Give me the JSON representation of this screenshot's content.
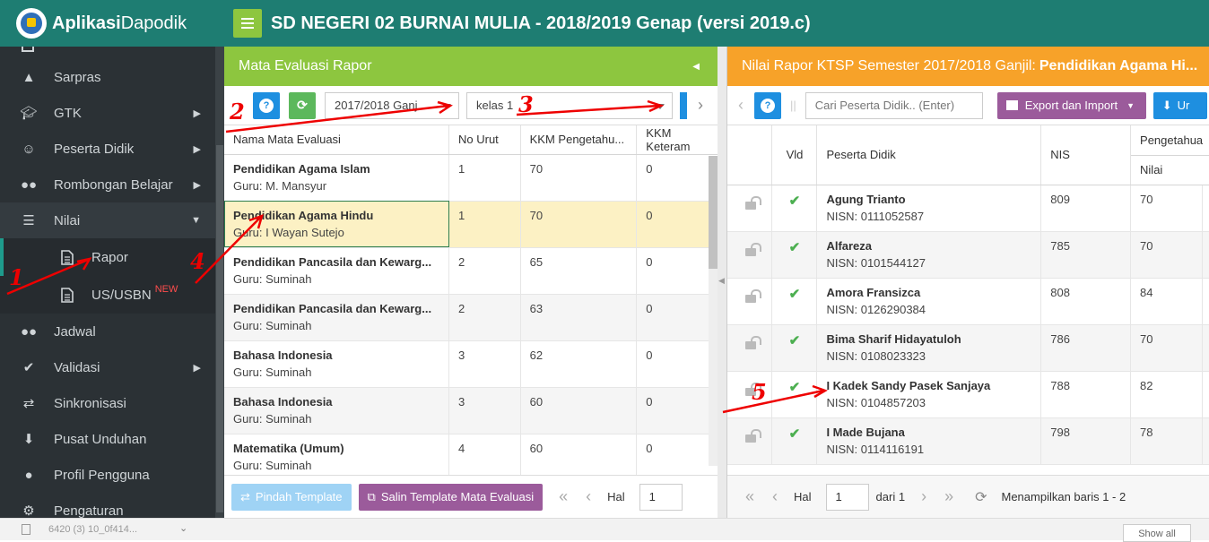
{
  "app": {
    "brand_bold": "Aplikasi",
    "brand_rest": "Dapodik",
    "title": "SD NEGERI 02 BURNAI MULIA - 2018/2019 Genap (versi 2019.c)"
  },
  "sidebar": {
    "items": [
      {
        "label": "Sarpras",
        "icon": "building-icon"
      },
      {
        "label": "GTK",
        "icon": "graduation-cap-icon"
      },
      {
        "label": "Peserta Didik",
        "icon": "smile-icon"
      },
      {
        "label": "Rombongan Belajar",
        "icon": "group-icon"
      },
      {
        "label": "Nilai",
        "icon": "list-icon"
      },
      {
        "label": "Rapor",
        "icon": "file-icon"
      },
      {
        "label": "US/USBN",
        "icon": "file-icon",
        "badge": "NEW"
      },
      {
        "label": "Jadwal",
        "icon": "group-icon"
      },
      {
        "label": "Validasi",
        "icon": "check-icon"
      },
      {
        "label": "Sinkronisasi",
        "icon": "exchange-icon"
      },
      {
        "label": "Pusat Unduhan",
        "icon": "download-icon"
      },
      {
        "label": "Profil Pengguna",
        "icon": "user-icon"
      },
      {
        "label": "Pengaturan",
        "icon": "gear-icon"
      }
    ]
  },
  "left_panel": {
    "title": "Mata Evaluasi Rapor",
    "semester": "2017/2018 Ganj",
    "kelas": "kelas 1",
    "columns": [
      "Nama Mata Evaluasi",
      "No Urut",
      "KKM Pengetahu...",
      "KKM Keteram"
    ],
    "rows": [
      {
        "name": "Pendidikan Agama Islam",
        "guru": "Guru: M. Mansyur",
        "no": "1",
        "kkm_p": "70",
        "kkm_k": "0"
      },
      {
        "name": "Pendidikan Agama Hindu",
        "guru": "Guru: I Wayan Sutejo",
        "no": "1",
        "kkm_p": "70",
        "kkm_k": "0"
      },
      {
        "name": "Pendidikan Pancasila dan Kewarg...",
        "guru": "Guru: Suminah",
        "no": "2",
        "kkm_p": "65",
        "kkm_k": "0"
      },
      {
        "name": "Pendidikan Pancasila dan Kewarg...",
        "guru": "Guru: Suminah",
        "no": "2",
        "kkm_p": "63",
        "kkm_k": "0"
      },
      {
        "name": "Bahasa Indonesia",
        "guru": "Guru: Suminah",
        "no": "3",
        "kkm_p": "62",
        "kkm_k": "0"
      },
      {
        "name": "Bahasa Indonesia",
        "guru": "Guru: Suminah",
        "no": "3",
        "kkm_p": "60",
        "kkm_k": "0"
      },
      {
        "name": "Matematika (Umum)",
        "guru": "Guru: Suminah",
        "no": "4",
        "kkm_p": "60",
        "kkm_k": "0"
      }
    ],
    "btn_pindah": "Pindah Template",
    "btn_salin": "Salin Template Mata Evaluasi",
    "hal_label": "Hal",
    "hal_value": "1"
  },
  "right_panel": {
    "title_prefix": "Nilai Rapor KTSP Semester 2017/2018 Ganjil: ",
    "title_bold": "Pendidikan Agama Hi...",
    "search_placeholder": "Cari Peserta Didik.. (Enter)",
    "export_label": "Export dan Import",
    "upload_label": "Ur",
    "columns": {
      "vld": "Vld",
      "peserta": "Peserta Didik",
      "nis": "NIS",
      "pengetahuan": "Pengetahua",
      "nilai": "Nilai"
    },
    "rows": [
      {
        "name": "Agung Trianto",
        "nisn": "NISN: 0111052587",
        "nis": "809",
        "nilai": "70"
      },
      {
        "name": "Alfareza",
        "nisn": "NISN: 0101544127",
        "nis": "785",
        "nilai": "70"
      },
      {
        "name": "Amora Fransizca",
        "nisn": "NISN: 0126290384",
        "nis": "808",
        "nilai": "84"
      },
      {
        "name": "Bima Sharif Hidayatuloh",
        "nisn": "NISN: 0108023323",
        "nis": "786",
        "nilai": "70"
      },
      {
        "name": "I Kadek Sandy Pasek Sanjaya",
        "nisn": "NISN: 0104857203",
        "nis": "788",
        "nilai": "82"
      },
      {
        "name": "I Made Bujana",
        "nisn": "NISN: 0114116191",
        "nis": "798",
        "nilai": "78"
      }
    ],
    "hal_label": "Hal",
    "hal_value": "1",
    "dari": "dari 1",
    "showing": "Menampilkan baris 1 - 2"
  },
  "statusbar": {
    "file": "6420 (3) 10_0f414...",
    "show_all": "Show all"
  },
  "annotations": [
    "1",
    "2",
    "3",
    "4",
    "5"
  ]
}
